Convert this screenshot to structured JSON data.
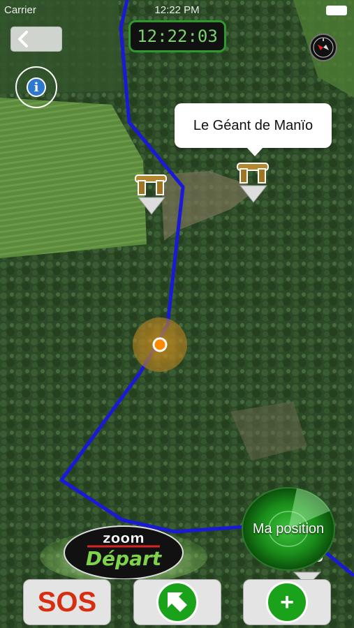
{
  "status_bar": {
    "carrier": "Carrier",
    "time": "12:22 PM"
  },
  "clock": {
    "time": "12:22:03"
  },
  "callout": {
    "title": "Le Géant de Manïo"
  },
  "buttons": {
    "sos_label": "SOS",
    "zoom_top": "zoom",
    "zoom_bottom": "Départ",
    "ma_position_label": "Ma position",
    "add_symbol": "+"
  },
  "icons": {
    "back": "chevron-left-icon",
    "info": "info-icon",
    "compass": "compass-icon",
    "poi": "dolmen-icon",
    "navigate": "arrow-icon",
    "add": "plus-icon"
  },
  "colors": {
    "route": "#1a1ad6",
    "clock_text": "#7bd36d",
    "sos_text": "#d62e10",
    "accent_green": "#1aa31a",
    "location_dot": "#ff8a00"
  }
}
